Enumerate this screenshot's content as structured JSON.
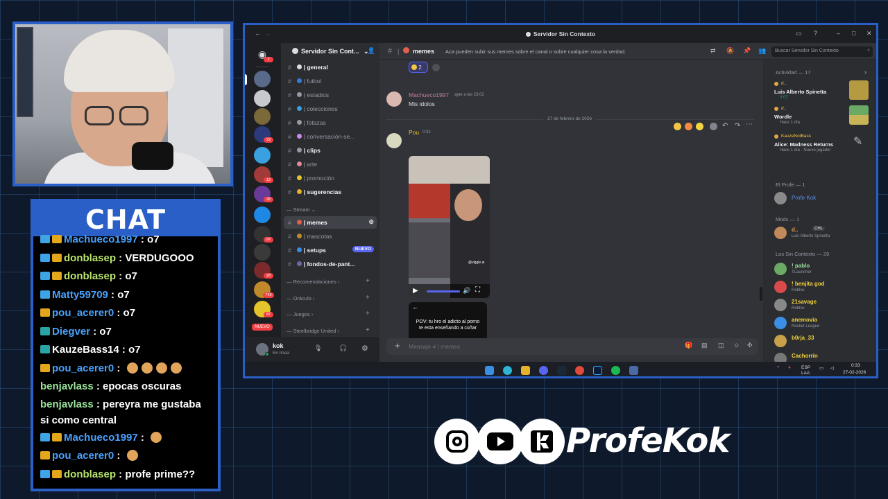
{
  "chat": {
    "title": "CHAT",
    "messages": [
      {
        "user": "Machueco1997",
        "text": " : o7",
        "user_color": "#4aa3ff",
        "badges": [
          "blue",
          "gold"
        ]
      },
      {
        "user": "donblasep",
        "text": " : VERDUGOOO",
        "user_color": "#b7e36b",
        "badges": [
          "blue",
          "gold"
        ]
      },
      {
        "user": "donblasep",
        "text": " : o7",
        "user_color": "#b7e36b",
        "badges": [
          "blue",
          "gold"
        ]
      },
      {
        "user": "Matty59709",
        "text": " : o7",
        "user_color": "#4aa3ff",
        "badges": [
          "blue"
        ]
      },
      {
        "user": "pou_acerer0",
        "text": " : o7",
        "user_color": "#4aa3ff",
        "badges": [
          "gold"
        ]
      },
      {
        "user": "Diegver",
        "text": " : o7",
        "user_color": "#4aa3ff",
        "badges": [
          "teal"
        ]
      },
      {
        "user": "KauzeBass14",
        "text": " : o7",
        "user_color": "#ffffff",
        "badges": [
          "teal"
        ]
      },
      {
        "user": "pou_acerer0",
        "text": " : ",
        "user_color": "#4aa3ff",
        "badges": [
          "gold"
        ],
        "emotes": 4
      },
      {
        "user": "benjavlass",
        "text": " : epocas oscuras",
        "user_color": "#9be39b",
        "badges": []
      },
      {
        "user": "benjavlass",
        "text": " : pereyra me gustaba si como central",
        "user_color": "#9be39b",
        "badges": [],
        "wrap": true
      },
      {
        "user": "Machueco1997",
        "text": " : ",
        "user_color": "#4aa3ff",
        "badges": [
          "blue",
          "gold"
        ],
        "emotes": 1
      },
      {
        "user": "pou_acerer0",
        "text": " : ",
        "user_color": "#4aa3ff",
        "badges": [
          "gold"
        ],
        "emotes": 1
      },
      {
        "user": "donblasep",
        "text": " : profe prime??",
        "user_color": "#b7e36b",
        "badges": [
          "blue",
          "gold"
        ]
      }
    ]
  },
  "discord": {
    "window_title": "Servidor Sin Contexto",
    "server_name": "Servidor Sin Cont...",
    "channels": [
      {
        "name": "| general",
        "bright": true
      },
      {
        "name": "| futbol",
        "bright": false
      },
      {
        "name": "| estadios",
        "bright": false
      },
      {
        "name": "| colecciones",
        "bright": false
      },
      {
        "name": "| fotazas",
        "bright": false
      },
      {
        "name": "| conversación-se...",
        "bright": false
      },
      {
        "name": "| clips",
        "bright": true
      },
      {
        "name": "| arte",
        "bright": false
      },
      {
        "name": "| promoción",
        "bright": false
      },
      {
        "name": "| sugerencias",
        "bright": true
      }
    ],
    "stream_category": "Stream",
    "stream_channels": [
      {
        "name": "| memes",
        "active": true
      },
      {
        "name": "| mascotas",
        "active": false
      },
      {
        "name": "| setups",
        "active": false,
        "badge": "NUEVO"
      },
      {
        "name": "| fondos-de-pant...",
        "active": false
      }
    ],
    "categories": [
      "Recomendaciones",
      "Oráculo",
      "Juegos",
      "Steelbridge United"
    ],
    "user": {
      "name": "kok",
      "status": "En línea"
    },
    "guild_badges": [
      "2",
      "22",
      "12",
      "38",
      "97",
      "28",
      "749",
      "87",
      "NUEVO"
    ],
    "channel_header": {
      "name": "memes",
      "topic": "Aca pueden subir sus memes sobre el canal o sobre cualquier cosa la verdad.",
      "search_placeholder": "Buscar Servidor Sin Contexto"
    },
    "messages": {
      "reaction_count": "2",
      "msg1": {
        "author": "Machueco1997",
        "time": "ayer a las 23:02",
        "text": "Mis idolos"
      },
      "date_divider": "27 de febrero de 2026",
      "msg2": {
        "author": "Pou",
        "time": "0:32"
      },
      "video_watermark": "@viggle.ai",
      "video2_text": "POV: tu hro el adicto al porno te esta enseñando a cuñar"
    },
    "message_placeholder": "Mensaje # | memes",
    "members": {
      "activity_header": "Actividad — 17",
      "activities": [
        {
          "tag": "d..",
          "name": "Luis Alberto Spinetta",
          "sub": "3:07"
        },
        {
          "tag": "d..",
          "name": "Wordle",
          "sub": "Hace 1 día"
        },
        {
          "tag": "KauzeNotBass",
          "name": "Alice: Madness Returns",
          "sub": "Hace 1 día · Nuevo jugador"
        }
      ],
      "profe_header": "El Profe — 1",
      "profe": "Profe Kok",
      "mods_header": "Mods — 1",
      "mod": {
        "name": "d..",
        "tag": "CHL",
        "sub": "Luis Alberto Spinetta"
      },
      "sin_contexto_header": "Los Sin Contexto — 29",
      "list": [
        {
          "name": "! pablo",
          "sub": "TLauncher",
          "color": "#9be39b"
        },
        {
          "name": "! benjita god",
          "sub": "Roblox",
          "color": "#f5d33b"
        },
        {
          "name": "21savage",
          "sub": "Roblox",
          "color": "#f5d33b"
        },
        {
          "name": "anemovia",
          "sub": "Rocket League",
          "color": "#f5d33b"
        },
        {
          "name": "b0rja_33",
          "sub": "",
          "color": "#f5d33b"
        },
        {
          "name": "Cachorrin",
          "sub": "",
          "color": "#f5d33b"
        }
      ]
    },
    "taskbar": {
      "lang": "ESP LAA",
      "time": "0:33",
      "date": "27-02-2026"
    }
  },
  "socials": {
    "handle": "ProfeKok",
    "icons": [
      "instagram-icon",
      "youtube-icon",
      "kick-icon"
    ]
  }
}
